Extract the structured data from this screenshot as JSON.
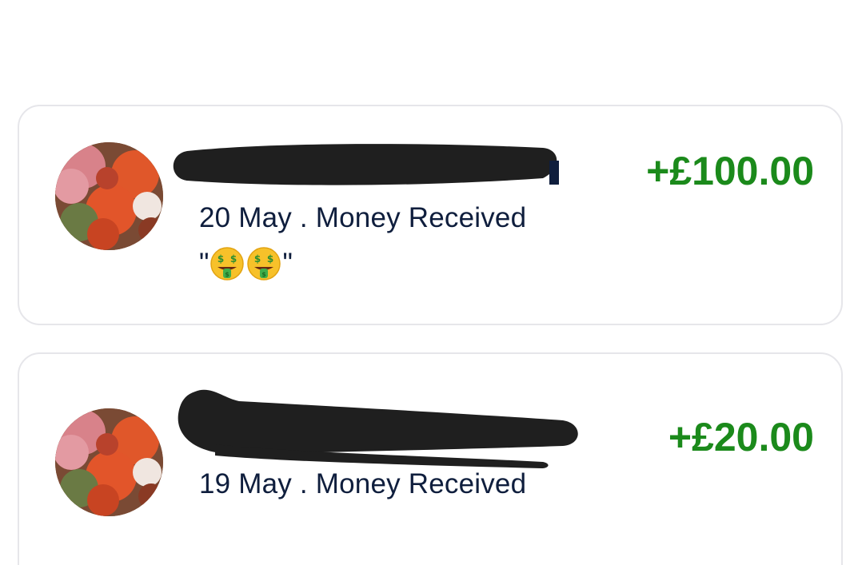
{
  "transactions": [
    {
      "name": "",
      "date": "20 May",
      "separator": " . ",
      "type": "Money Received",
      "note_open": "\"",
      "note_close": "\"",
      "note_emojis": [
        "money-mouth-face-icon",
        "money-mouth-face-icon"
      ],
      "amount": "+£100.00"
    },
    {
      "name": "",
      "date": "19 May",
      "separator": " . ",
      "type": "Money Received",
      "amount": "+£20.00"
    }
  ],
  "colors": {
    "amount": "#1b8a1b",
    "text": "#0f1e3d",
    "card_border": "#e6e6ea",
    "redaction": "#1f1f1f"
  }
}
